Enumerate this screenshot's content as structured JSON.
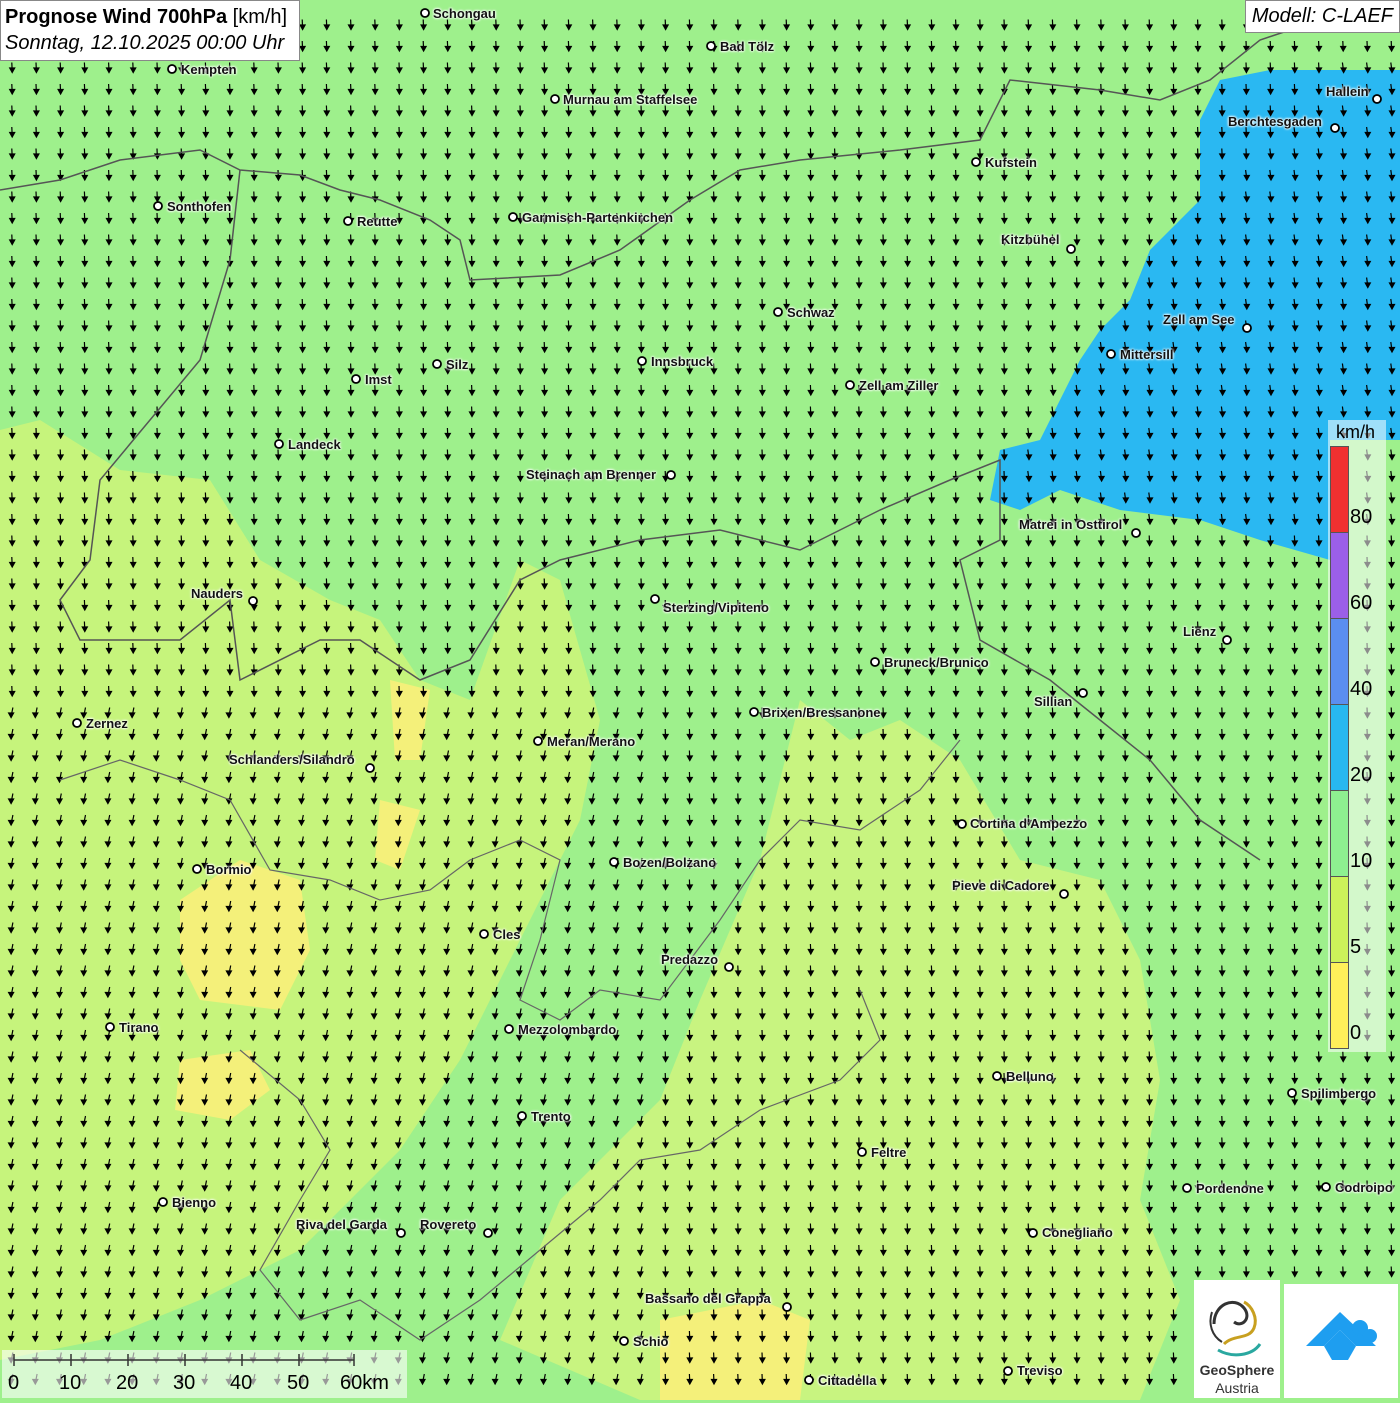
{
  "title": {
    "main_bold": "Prognose Wind 700hPa",
    "main_unit": " [km/h]",
    "date": "Sonntag, 12.10.2025 00:00 Uhr"
  },
  "model": "Modell: C-LAEF",
  "legend": {
    "unit": "km/h",
    "steps": [
      {
        "label": "80",
        "color": "#f03030"
      },
      {
        "label": "60",
        "color": "#9b5fe8"
      },
      {
        "label": "40",
        "color": "#5b8ef0"
      },
      {
        "label": "20",
        "color": "#28b8f0"
      },
      {
        "label": "10",
        "color": "#8ef090"
      },
      {
        "label": "5",
        "color": "#ccf25a"
      },
      {
        "label": "0",
        "color": "#fff05a"
      }
    ]
  },
  "scale": {
    "labels": [
      "0",
      "10",
      "20",
      "30",
      "40",
      "50",
      "60km"
    ]
  },
  "cities": [
    {
      "name": "Schongau"
    },
    {
      "name": "Bad Tölz"
    },
    {
      "name": "Kempten"
    },
    {
      "name": "Murnau am Staffelsee"
    },
    {
      "name": "Hallein"
    },
    {
      "name": "Berchtesgaden"
    },
    {
      "name": "Kufstein"
    },
    {
      "name": "Sonthofen"
    },
    {
      "name": "Reutte"
    },
    {
      "name": "Garmisch-Partenkirchen"
    },
    {
      "name": "Kitzbühel"
    },
    {
      "name": "Schwaz"
    },
    {
      "name": "Zell am See"
    },
    {
      "name": "Mittersill"
    },
    {
      "name": "Innsbruck"
    },
    {
      "name": "Silz"
    },
    {
      "name": "Imst"
    },
    {
      "name": "Zell am Ziller"
    },
    {
      "name": "Landeck"
    },
    {
      "name": "Steinach am Brenner"
    },
    {
      "name": "Matrei in Osttirol"
    },
    {
      "name": "Nauders"
    },
    {
      "name": "Sterzing/Vipiteno"
    },
    {
      "name": "Lienz"
    },
    {
      "name": "Bruneck/Brunico"
    },
    {
      "name": "Sillian"
    },
    {
      "name": "Zernez"
    },
    {
      "name": "Brixen/Bressanone"
    },
    {
      "name": "Meran/Merano"
    },
    {
      "name": "Schlanders/Silandro"
    },
    {
      "name": "Cortina d'Ampezzo"
    },
    {
      "name": "Bozen/Bolzano"
    },
    {
      "name": "Bormio"
    },
    {
      "name": "Pieve di Cadore"
    },
    {
      "name": "Cles"
    },
    {
      "name": "Predazzo"
    },
    {
      "name": "Tirano"
    },
    {
      "name": "Mezzolombardo"
    },
    {
      "name": "Belluno"
    },
    {
      "name": "Spilimbergo"
    },
    {
      "name": "Trento"
    },
    {
      "name": "Feltre"
    },
    {
      "name": "Bienno"
    },
    {
      "name": "Pordenone"
    },
    {
      "name": "Codroipo"
    },
    {
      "name": "Riva del Garda"
    },
    {
      "name": "Rovereto"
    },
    {
      "name": "Conegliano"
    },
    {
      "name": "Bassano del Grappa"
    },
    {
      "name": "Schio"
    },
    {
      "name": "Treviso"
    },
    {
      "name": "Cittadella"
    }
  ],
  "logos": {
    "geosphere_line1": "GeoSphere",
    "geosphere_line2": "Austria"
  }
}
